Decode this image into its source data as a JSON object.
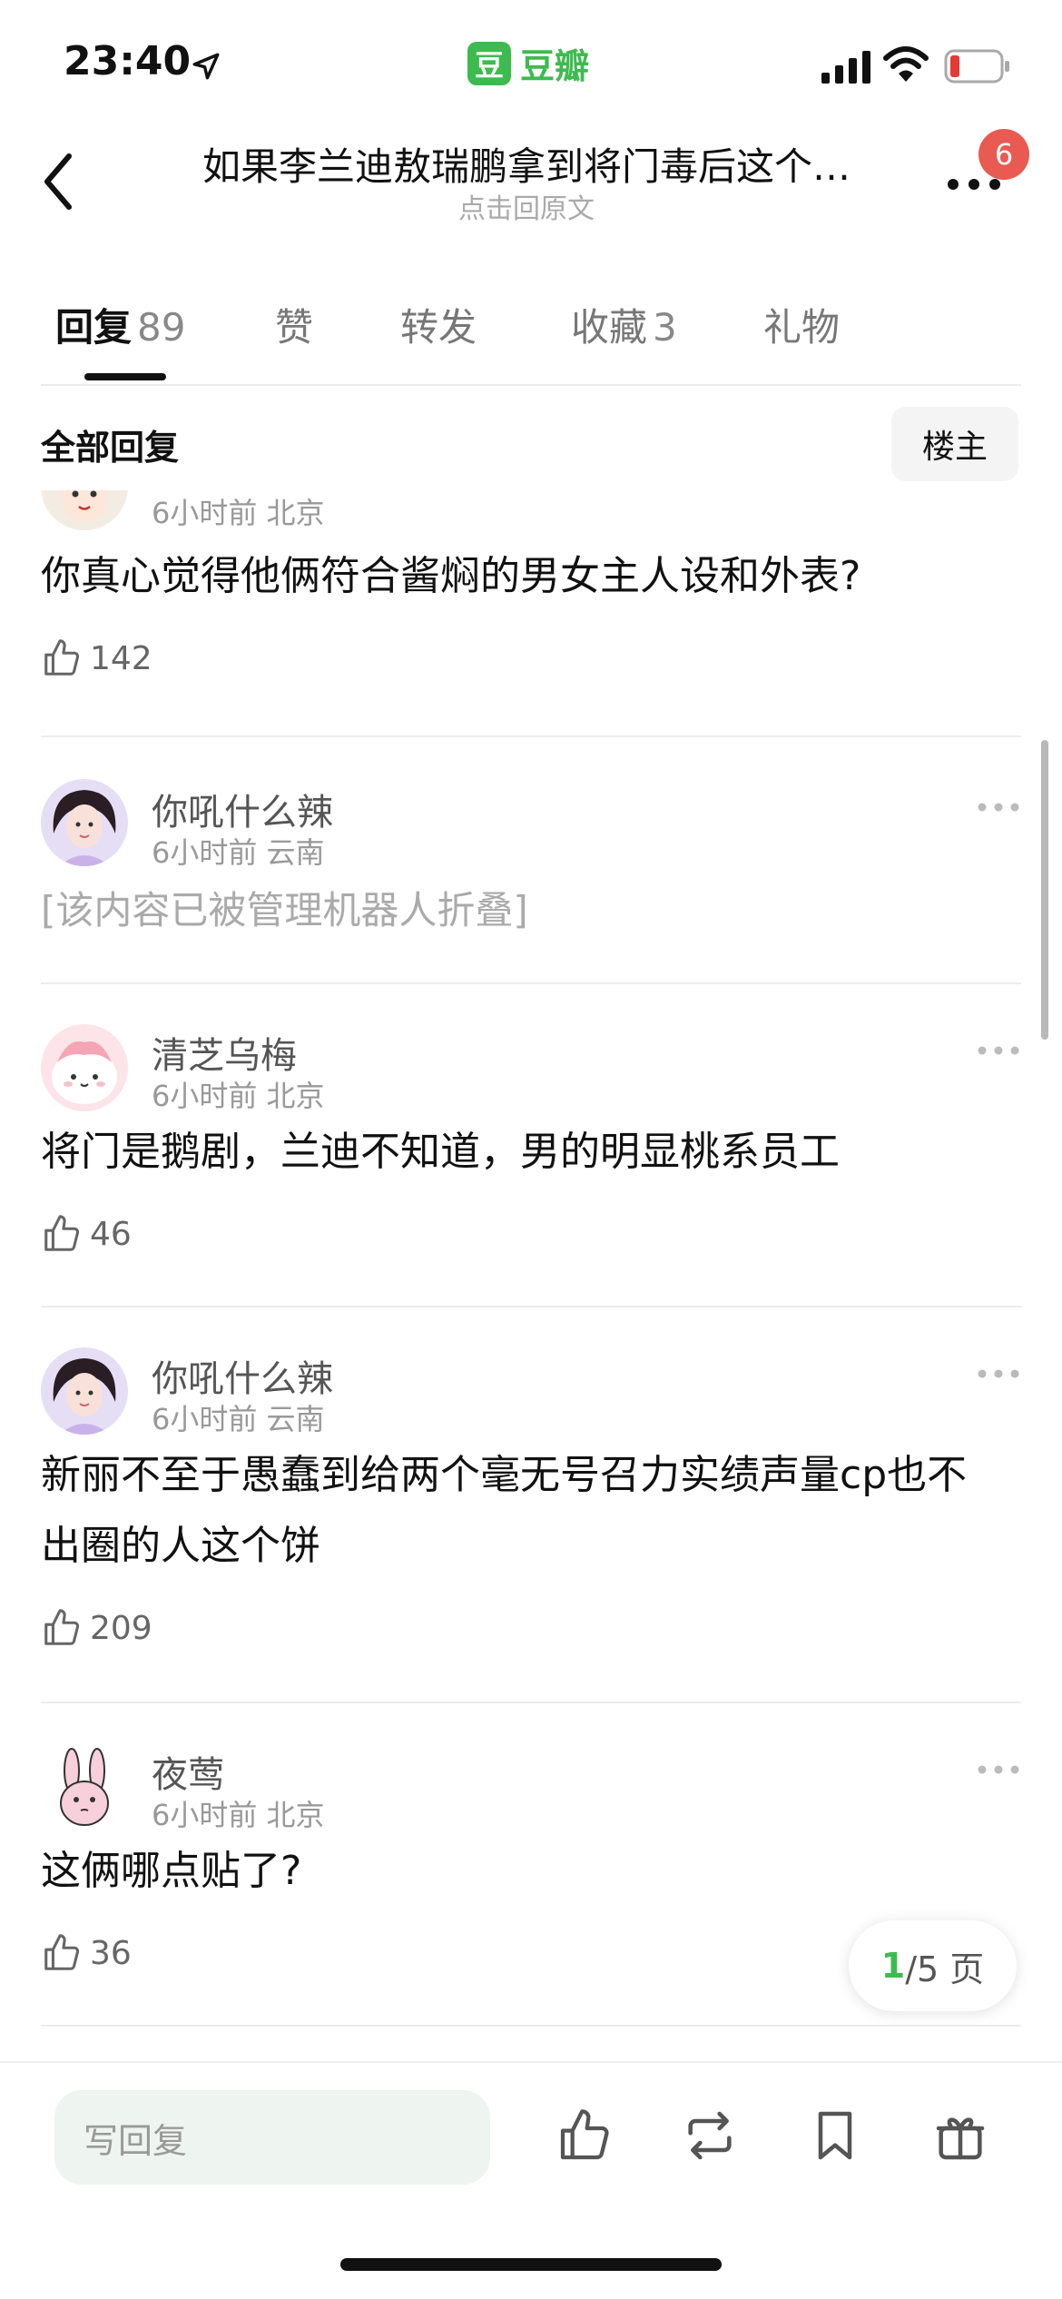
{
  "status_bar": {
    "time": "23:40",
    "app_logo_char": "豆",
    "app_name": "豆瓣"
  },
  "nav": {
    "title": "如果李兰迪敖瑞鹏拿到将门毒后这个…",
    "subtitle": "点击回原文",
    "notification_count": "6"
  },
  "tabs": [
    {
      "label": "回复",
      "count": "89",
      "active": true
    },
    {
      "label": "赞",
      "count": ""
    },
    {
      "label": "转发",
      "count": ""
    },
    {
      "label": "收藏",
      "count": "3"
    },
    {
      "label": "礼物",
      "count": ""
    }
  ],
  "section": {
    "title": "全部回复",
    "filter_label": "楼主"
  },
  "comments": [
    {
      "name": "",
      "time": "6小时前",
      "location": "北京",
      "text": "你真心觉得他俩符合酱焖的男女主人设和外表?",
      "likes": "142"
    },
    {
      "name": "你吼什么辣",
      "time": "6小时前",
      "location": "云南",
      "text": "[该内容已被管理机器人折叠]",
      "likes": ""
    },
    {
      "name": "清芝乌梅",
      "time": "6小时前",
      "location": "北京",
      "text": "将门是鹅剧，兰迪不知道，男的明显桃系员工",
      "likes": "46"
    },
    {
      "name": "你吼什么辣",
      "time": "6小时前",
      "location": "云南",
      "text": "新丽不至于愚蠢到给两个毫无号召力实绩声量cp也不出圈的人这个饼",
      "likes": "209"
    },
    {
      "name": "夜莺",
      "time": "6小时前",
      "location": "北京",
      "text": "这俩哪点贴了?",
      "likes": "36"
    }
  ],
  "pagination": {
    "current": "1",
    "rest": "/5 页"
  },
  "bottom_bar": {
    "reply_placeholder": "写回复"
  },
  "colors": {
    "accent": "#3dbb4f",
    "badge": "#e85a52"
  }
}
